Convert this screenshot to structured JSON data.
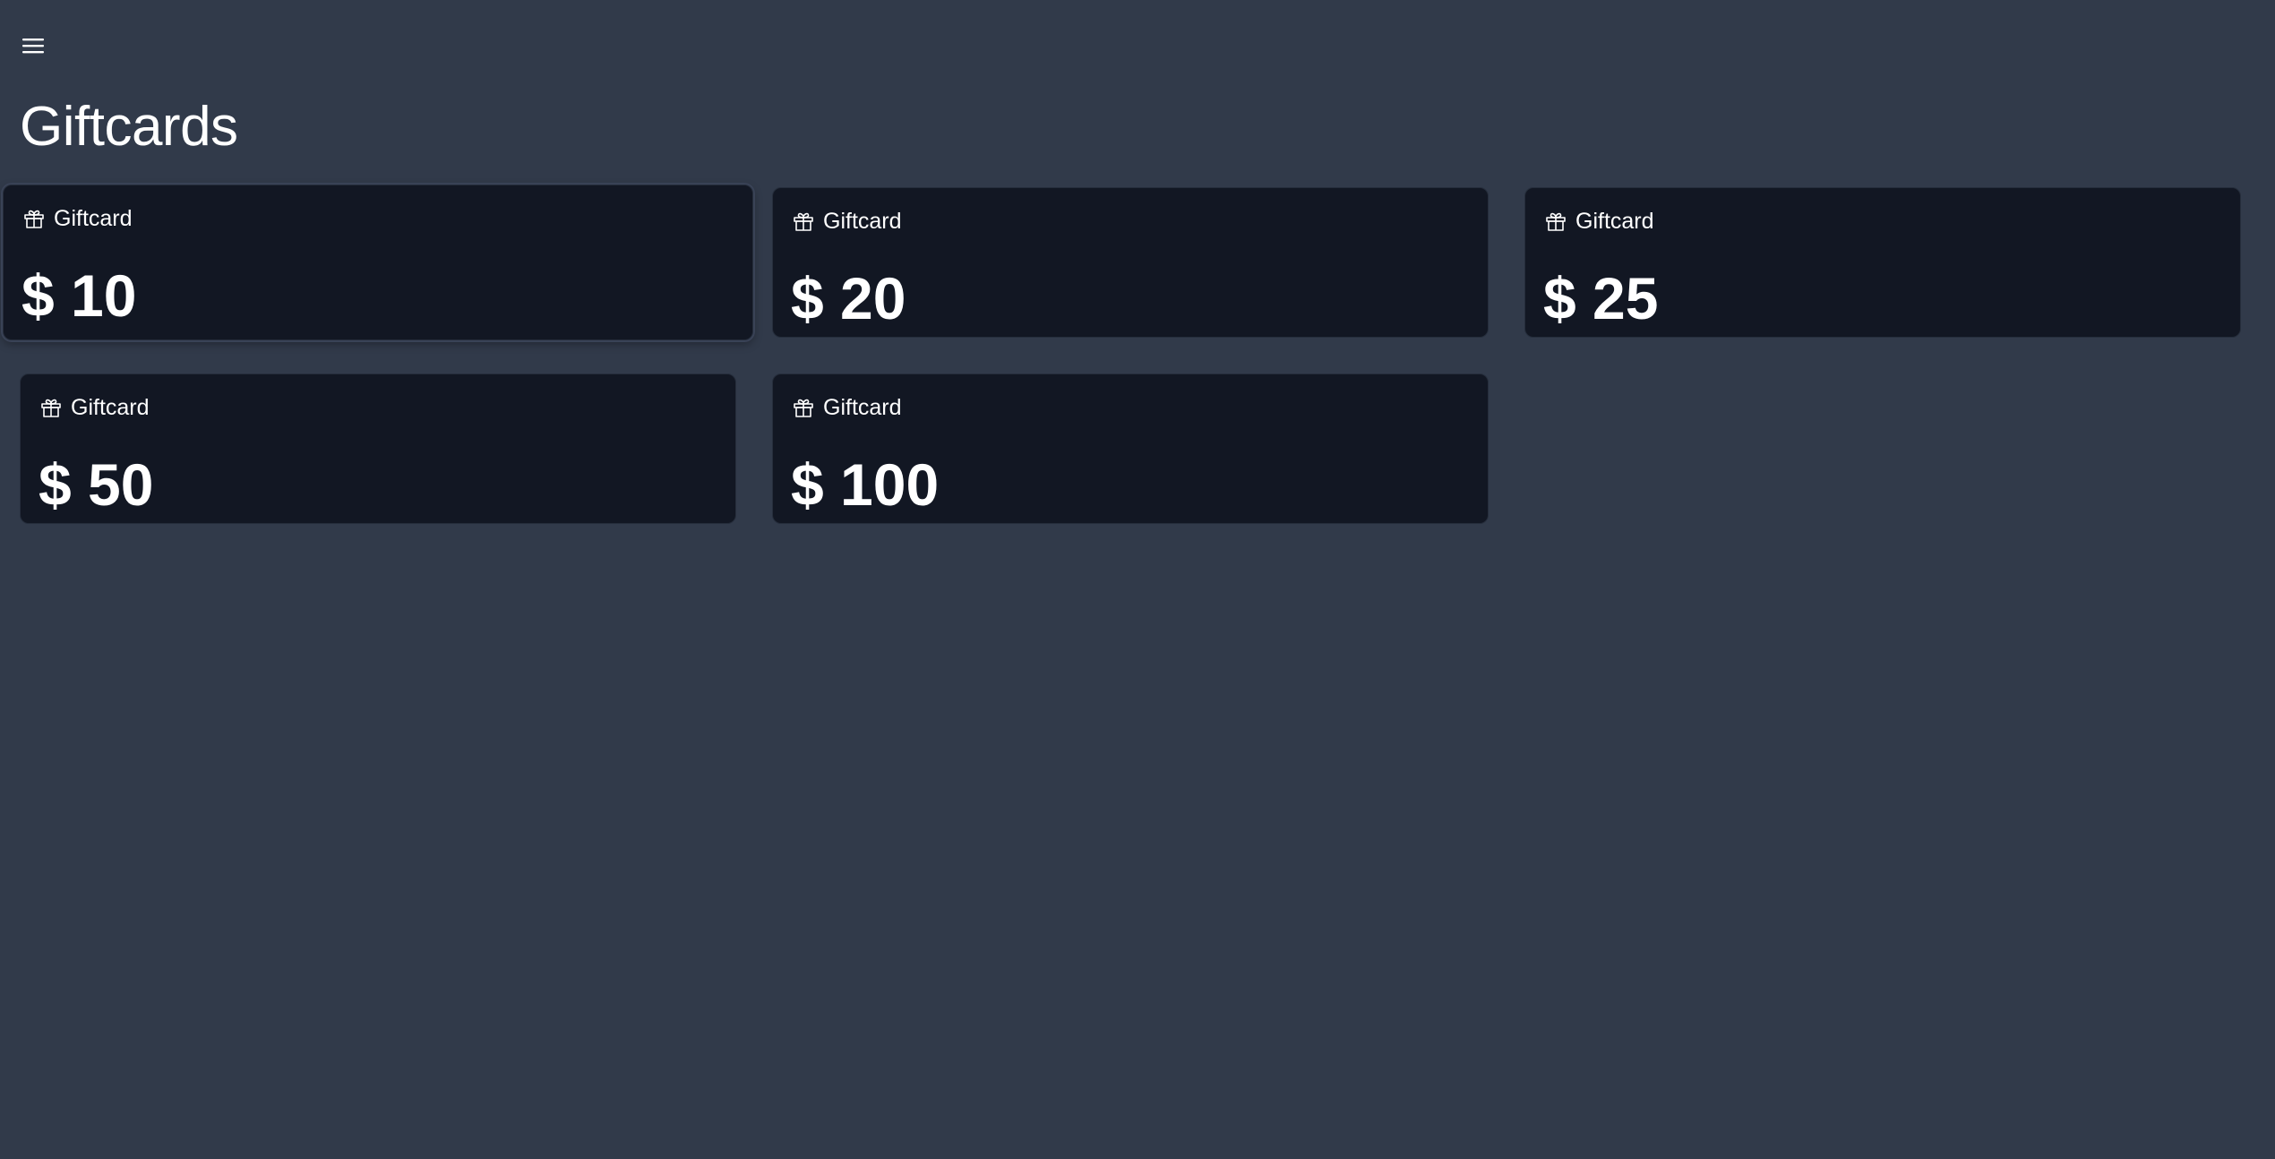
{
  "header": {
    "menu_icon": "hamburger-menu-icon",
    "title": "Giftcards"
  },
  "giftcards": [
    {
      "label": "Giftcard",
      "amount": "$ 10",
      "icon": "gift-icon"
    },
    {
      "label": "Giftcard",
      "amount": "$ 20",
      "icon": "gift-icon"
    },
    {
      "label": "Giftcard",
      "amount": "$ 25",
      "icon": "gift-icon"
    },
    {
      "label": "Giftcard",
      "amount": "$ 50",
      "icon": "gift-icon"
    },
    {
      "label": "Giftcard",
      "amount": "$ 100",
      "icon": "gift-icon"
    }
  ],
  "colors": {
    "background": "#313a4a",
    "card_background": "#121723",
    "text": "#ffffff"
  }
}
